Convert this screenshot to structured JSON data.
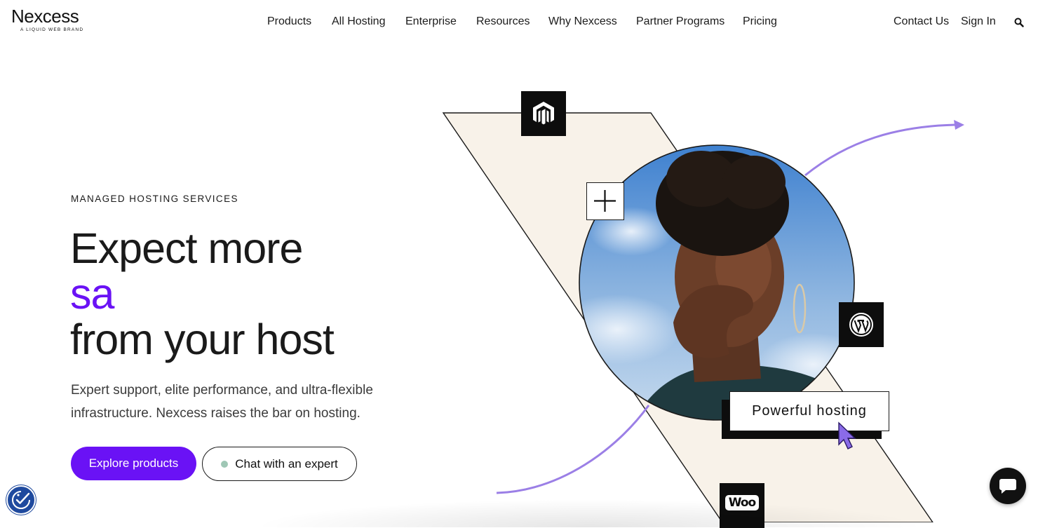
{
  "brand": {
    "name": "Nexcess",
    "tagline": "A LIQUID WEB BRAND"
  },
  "nav": {
    "items": [
      "Products",
      "All Hosting",
      "Enterprise",
      "Resources",
      "Why Nexcess",
      "Partner Programs",
      "Pricing"
    ],
    "contact": "Contact Us",
    "sign_in": "Sign In"
  },
  "hero": {
    "eyebrow": "MANAGED HOSTING SERVICES",
    "headline_line1": "Expect more",
    "headline_typed": "sa",
    "headline_line3": "from your host",
    "subcopy": "Expert support, elite performance, and ultra-flexible infrastructure. Nexcess raises the bar on hosting.",
    "primary_cta": "Explore products",
    "secondary_cta": "Chat with an expert"
  },
  "illustration": {
    "callout": "Powerful hosting",
    "woo_label": "Woo"
  },
  "colors": {
    "accent": "#6a12f5",
    "arrow": "#9b7fe6",
    "band": "#f8f2e9",
    "tile": "#0d0d0d",
    "status_dot": "#9fc7b5"
  },
  "icons": [
    "magento-icon",
    "plus-icon",
    "wordpress-icon",
    "woocommerce-icon",
    "search-icon",
    "cursor-icon",
    "accessibility-icon",
    "chat-icon"
  ]
}
